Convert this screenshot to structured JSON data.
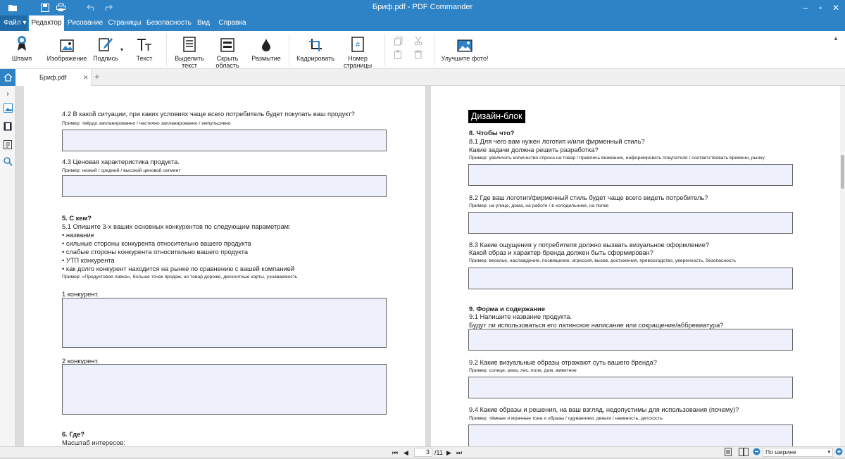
{
  "window": {
    "title": "Бриф.pdf - PDF Commander"
  },
  "menu": {
    "file": "Файл",
    "tabs": [
      "Редактор",
      "Рисование",
      "Страницы",
      "Безопасность",
      "Вид",
      "Справка"
    ]
  },
  "ribbon": {
    "stamp": "Штамп",
    "image": "Изображение",
    "signature": "Подпись",
    "text": "Текст",
    "select_text_1": "Выделить",
    "select_text_2": "текст",
    "hide_area_1": "Скрыть",
    "hide_area_2": "область",
    "blur": "Размытие",
    "crop": "Кадрировать",
    "page_number_1": "Номер",
    "page_number_2": "страницы",
    "enhance_photo": "Улучшите фото!"
  },
  "doc_tab": {
    "name": "Бриф.pdf",
    "plus": "+"
  },
  "left_page": {
    "q42": "4.2 В какой ситуации, при каких условиях чаще всего потребитель будет покупать ваш продукт?",
    "ex42": "Пример: твёрдо запланированно / частично запланированно / импульсивно",
    "q43": "4.3 Ценовая характеристика продукта.",
    "ex43": "Пример: низкий / средний / высокий ценовой сегмент",
    "h5": "5. С кем?",
    "q51": "5.1 Опишите 3-х ваших основных конкурентов по следующим параметрам:",
    "bullets": [
      "• название",
      "• сильные стороны конкурента относительно вашего продукта",
      "• слабые стороны конкурента относительно вашего продукта",
      "• УТП конкурента",
      "• как долго конкурент находится на рынке по сравнению с вашей компанией"
    ],
    "ex51": "Пример: «Продуктовая лавка», больше точек продаж, но товар дороже, дисконтные карты, узнаваемость",
    "c1": "1 конкурент.",
    "c2": "2 конкурент.",
    "h6": "6. Где?",
    "scale": "Масштаб интересов:"
  },
  "right_page": {
    "header": "Дизайн-блок",
    "h8": "8. Чтобы что?",
    "q81a": "8.1 Для чего вам нужен логотип и/или фирменный стиль?",
    "q81b": "Какие задачи должна решить разработка?",
    "ex81": "Пример: увеличить количество спроса на товар / привлечь внимание, информировать покупателя / соответствовать времени, рынку",
    "q82": "8.2 Где ваш логотип/фирменный стиль будет чаще всего видеть потребитель?",
    "ex82": "Пример: на улице, дома, на работе / в холодильнике, на полке",
    "q83a": "8.3 Какие ощущения у потребителя должно вызвать визуальное оформление?",
    "q83b": "Какой образ и характер бренда должен быть сформирован?",
    "ex83": "Пример: веселье, наслаждение, посвящение, агрессия, вызов, достижения, превосходство, уверенность, безопасность",
    "h9": "9. Форма и содержание",
    "q91a": "9.1 Напишите название продукта.",
    "q91b": "Будут ли использоваться его латинское написание или сокращение/аббревиатура?",
    "q92": "9.2 Какие визуальные образы отражают суть вашего бренда?",
    "ex92": "Пример: солнце, река, лес, поле, дом, животное",
    "q94": "9.4 Какие образы и решения, на ваш взгляд, недопустимы для использования (почему)?",
    "ex94": "Пример: тёмные и мрачные тона и образы / одуванчики, деньги / наивность, детскость"
  },
  "status": {
    "page_current": "3",
    "page_total": "/11",
    "zoom": "По ширине"
  },
  "colors": {
    "accent": "#2e83c7",
    "field": "#eef0fc"
  }
}
